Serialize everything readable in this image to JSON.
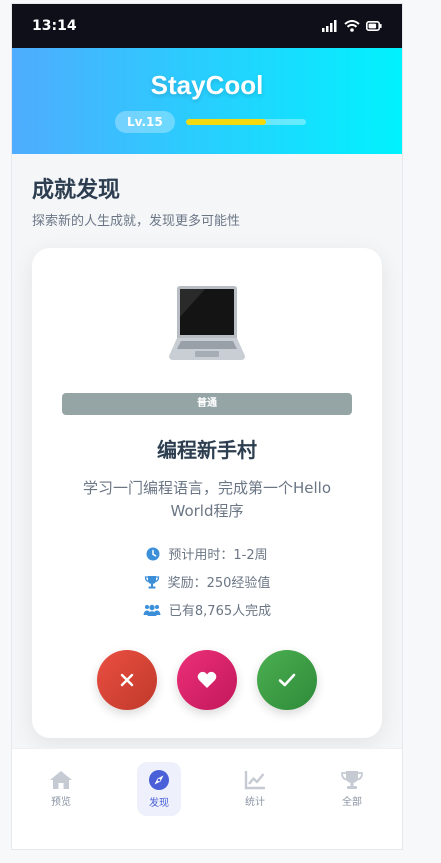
{
  "status": {
    "time": "13:14"
  },
  "header": {
    "app_title": "StayCool",
    "level": "Lv.15",
    "xp_progress": 0.67
  },
  "section": {
    "title": "成就发现",
    "subtitle": "探索新的人生成就，发现更多可能性"
  },
  "card": {
    "emoji": "💻",
    "rarity": "普通",
    "title": "编程新手村",
    "description": "学习一门编程语言，完成第一个Hello World程序",
    "meta": {
      "time": "预计用时：1-2周",
      "reward": "奖励：250经验值",
      "completed": "已有8,765人完成"
    }
  },
  "colors": {
    "rarity_common": "#95a5a6",
    "accent": "#4a60d8"
  },
  "tabs": [
    {
      "label": "预览",
      "icon": "home-icon",
      "active": false
    },
    {
      "label": "发现",
      "icon": "compass-icon",
      "active": true
    },
    {
      "label": "统计",
      "icon": "chart-icon",
      "active": false
    },
    {
      "label": "全部",
      "icon": "trophy-icon",
      "active": false
    }
  ]
}
